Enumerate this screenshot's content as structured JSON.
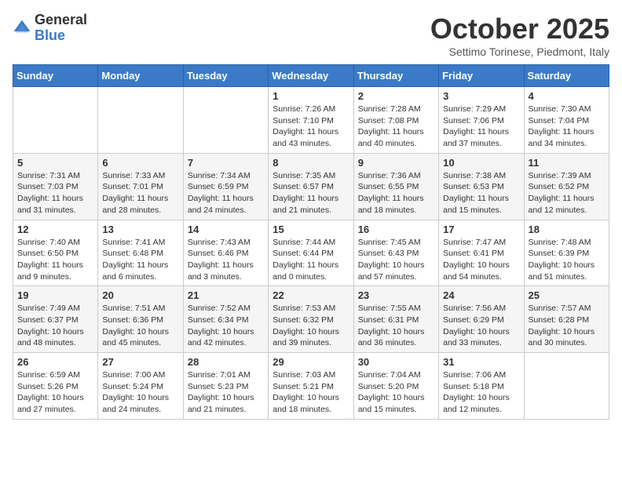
{
  "logo": {
    "general": "General",
    "blue": "Blue"
  },
  "title": "October 2025",
  "subtitle": "Settimo Torinese, Piedmont, Italy",
  "days_of_week": [
    "Sunday",
    "Monday",
    "Tuesday",
    "Wednesday",
    "Thursday",
    "Friday",
    "Saturday"
  ],
  "weeks": [
    [
      {
        "day": "",
        "info": ""
      },
      {
        "day": "",
        "info": ""
      },
      {
        "day": "",
        "info": ""
      },
      {
        "day": "1",
        "info": "Sunrise: 7:26 AM\nSunset: 7:10 PM\nDaylight: 11 hours and 43 minutes."
      },
      {
        "day": "2",
        "info": "Sunrise: 7:28 AM\nSunset: 7:08 PM\nDaylight: 11 hours and 40 minutes."
      },
      {
        "day": "3",
        "info": "Sunrise: 7:29 AM\nSunset: 7:06 PM\nDaylight: 11 hours and 37 minutes."
      },
      {
        "day": "4",
        "info": "Sunrise: 7:30 AM\nSunset: 7:04 PM\nDaylight: 11 hours and 34 minutes."
      }
    ],
    [
      {
        "day": "5",
        "info": "Sunrise: 7:31 AM\nSunset: 7:03 PM\nDaylight: 11 hours and 31 minutes."
      },
      {
        "day": "6",
        "info": "Sunrise: 7:33 AM\nSunset: 7:01 PM\nDaylight: 11 hours and 28 minutes."
      },
      {
        "day": "7",
        "info": "Sunrise: 7:34 AM\nSunset: 6:59 PM\nDaylight: 11 hours and 24 minutes."
      },
      {
        "day": "8",
        "info": "Sunrise: 7:35 AM\nSunset: 6:57 PM\nDaylight: 11 hours and 21 minutes."
      },
      {
        "day": "9",
        "info": "Sunrise: 7:36 AM\nSunset: 6:55 PM\nDaylight: 11 hours and 18 minutes."
      },
      {
        "day": "10",
        "info": "Sunrise: 7:38 AM\nSunset: 6:53 PM\nDaylight: 11 hours and 15 minutes."
      },
      {
        "day": "11",
        "info": "Sunrise: 7:39 AM\nSunset: 6:52 PM\nDaylight: 11 hours and 12 minutes."
      }
    ],
    [
      {
        "day": "12",
        "info": "Sunrise: 7:40 AM\nSunset: 6:50 PM\nDaylight: 11 hours and 9 minutes."
      },
      {
        "day": "13",
        "info": "Sunrise: 7:41 AM\nSunset: 6:48 PM\nDaylight: 11 hours and 6 minutes."
      },
      {
        "day": "14",
        "info": "Sunrise: 7:43 AM\nSunset: 6:46 PM\nDaylight: 11 hours and 3 minutes."
      },
      {
        "day": "15",
        "info": "Sunrise: 7:44 AM\nSunset: 6:44 PM\nDaylight: 11 hours and 0 minutes."
      },
      {
        "day": "16",
        "info": "Sunrise: 7:45 AM\nSunset: 6:43 PM\nDaylight: 10 hours and 57 minutes."
      },
      {
        "day": "17",
        "info": "Sunrise: 7:47 AM\nSunset: 6:41 PM\nDaylight: 10 hours and 54 minutes."
      },
      {
        "day": "18",
        "info": "Sunrise: 7:48 AM\nSunset: 6:39 PM\nDaylight: 10 hours and 51 minutes."
      }
    ],
    [
      {
        "day": "19",
        "info": "Sunrise: 7:49 AM\nSunset: 6:37 PM\nDaylight: 10 hours and 48 minutes."
      },
      {
        "day": "20",
        "info": "Sunrise: 7:51 AM\nSunset: 6:36 PM\nDaylight: 10 hours and 45 minutes."
      },
      {
        "day": "21",
        "info": "Sunrise: 7:52 AM\nSunset: 6:34 PM\nDaylight: 10 hours and 42 minutes."
      },
      {
        "day": "22",
        "info": "Sunrise: 7:53 AM\nSunset: 6:32 PM\nDaylight: 10 hours and 39 minutes."
      },
      {
        "day": "23",
        "info": "Sunrise: 7:55 AM\nSunset: 6:31 PM\nDaylight: 10 hours and 36 minutes."
      },
      {
        "day": "24",
        "info": "Sunrise: 7:56 AM\nSunset: 6:29 PM\nDaylight: 10 hours and 33 minutes."
      },
      {
        "day": "25",
        "info": "Sunrise: 7:57 AM\nSunset: 6:28 PM\nDaylight: 10 hours and 30 minutes."
      }
    ],
    [
      {
        "day": "26",
        "info": "Sunrise: 6:59 AM\nSunset: 5:26 PM\nDaylight: 10 hours and 27 minutes."
      },
      {
        "day": "27",
        "info": "Sunrise: 7:00 AM\nSunset: 5:24 PM\nDaylight: 10 hours and 24 minutes."
      },
      {
        "day": "28",
        "info": "Sunrise: 7:01 AM\nSunset: 5:23 PM\nDaylight: 10 hours and 21 minutes."
      },
      {
        "day": "29",
        "info": "Sunrise: 7:03 AM\nSunset: 5:21 PM\nDaylight: 10 hours and 18 minutes."
      },
      {
        "day": "30",
        "info": "Sunrise: 7:04 AM\nSunset: 5:20 PM\nDaylight: 10 hours and 15 minutes."
      },
      {
        "day": "31",
        "info": "Sunrise: 7:06 AM\nSunset: 5:18 PM\nDaylight: 10 hours and 12 minutes."
      },
      {
        "day": "",
        "info": ""
      }
    ]
  ]
}
